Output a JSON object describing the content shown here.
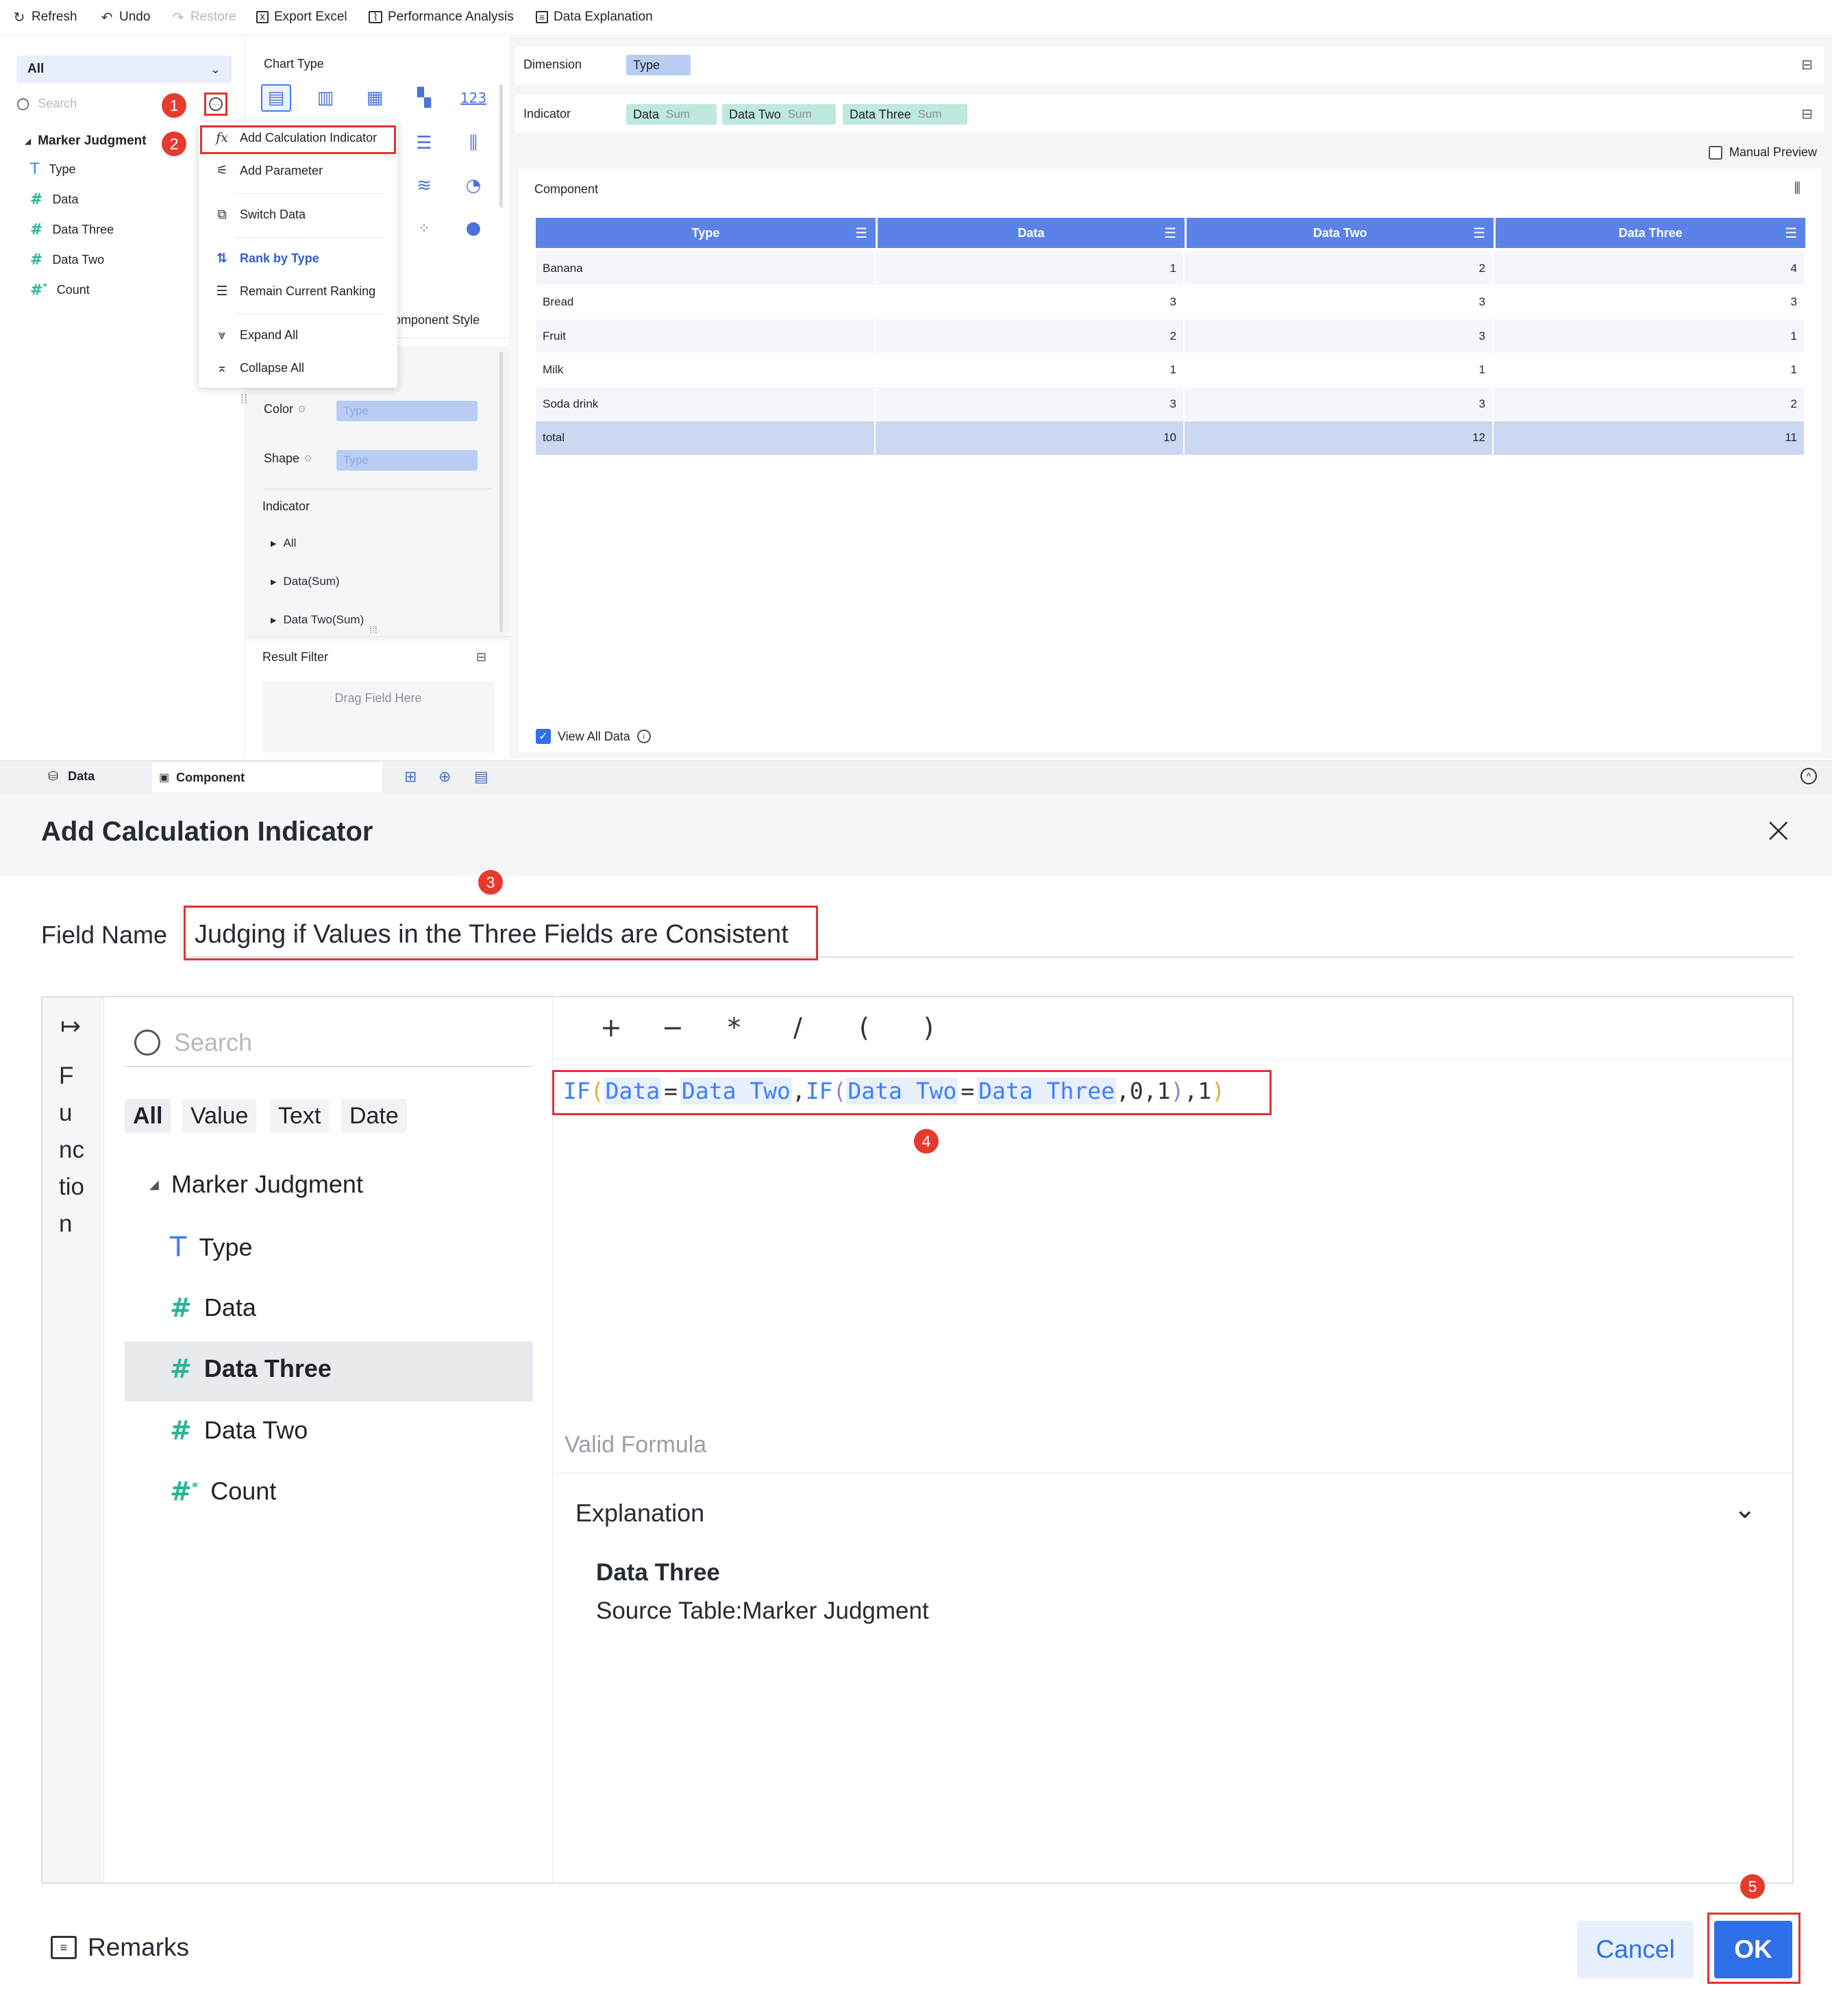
{
  "toolbar": {
    "refresh": "Refresh",
    "undo": "Undo",
    "restore": "Restore",
    "export_excel": "Export Excel",
    "performance_analysis": "Performance Analysis",
    "data_explanation": "Data Explanation"
  },
  "left_panel": {
    "filter_select": "All",
    "search_placeholder": "Search",
    "table_name": "Marker Judgment",
    "fields": [
      {
        "name": "Type",
        "icon": "text-type-icon"
      },
      {
        "name": "Data",
        "icon": "number-icon"
      },
      {
        "name": "Data Three",
        "icon": "number-icon"
      },
      {
        "name": "Data Two",
        "icon": "number-icon"
      },
      {
        "name": "Count",
        "icon": "number-calc-icon"
      }
    ]
  },
  "context_menu": {
    "add_calculation_indicator": "Add Calculation Indicator",
    "add_parameter": "Add Parameter",
    "switch_data": "Switch Data",
    "rank_by_type": "Rank by Type",
    "remain_current_ranking": "Remain Current Ranking",
    "expand_all": "Expand All",
    "collapse_all": "Collapse All"
  },
  "middle_panel": {
    "chart_type_label": "Chart Type",
    "component_style_tab": "omponent Style",
    "color_label": "Color",
    "shape_label": "Shape",
    "color_placeholder": "Type",
    "shape_placeholder": "Type",
    "indicator_label": "Indicator",
    "indicator_items": [
      "All",
      "Data(Sum)",
      "Data Two(Sum)"
    ],
    "result_filter_label": "Result Filter",
    "drag_field_here": "Drag Field Here"
  },
  "right_panel": {
    "dimension_label": "Dimension",
    "dimension_pill": "Type",
    "indicator_label": "Indicator",
    "indicator_pills": [
      {
        "name": "Data",
        "agg": "Sum"
      },
      {
        "name": "Data Two",
        "agg": "Sum"
      },
      {
        "name": "Data Three",
        "agg": "Sum"
      }
    ],
    "manual_preview": "Manual Preview",
    "component_label": "Component",
    "view_all_data": "View All Data"
  },
  "table": {
    "columns": [
      "Type",
      "Data",
      "Data Two",
      "Data Three"
    ],
    "rows": [
      [
        "Banana",
        "1",
        "2",
        "4"
      ],
      [
        "Bread",
        "3",
        "3",
        "3"
      ],
      [
        "Fruit",
        "2",
        "3",
        "1"
      ],
      [
        "Milk",
        "1",
        "1",
        "1"
      ],
      [
        "Soda drink",
        "3",
        "3",
        "2"
      ]
    ],
    "total": [
      "total",
      "10",
      "12",
      "11"
    ]
  },
  "bottom_tabs": {
    "data": "Data",
    "component": "Component"
  },
  "dialog": {
    "title": "Add Calculation Indicator",
    "field_name_label": "Field Name",
    "field_name_value": "Judging if Values in the Three Fields are Consistent",
    "side_tab_letters": [
      "F",
      "u",
      "nc",
      "tio",
      "n"
    ],
    "search_placeholder": "Search",
    "filter_tags": [
      "All",
      "Value",
      "Text",
      "Date"
    ],
    "tree_root": "Marker Judgment",
    "tree_fields": [
      "Type",
      "Data",
      "Data Three",
      "Data Two",
      "Count"
    ],
    "operators": [
      "+",
      "−",
      "*",
      "/",
      "(",
      ")"
    ],
    "formula": {
      "f1": "IF",
      "a": "Data",
      "eq": "=",
      "b": "Data Two",
      "comma": ",",
      "f2": "IF",
      "c": "Data Two",
      "d": "Data Three",
      "zero": "0",
      "one": "1"
    },
    "valid_formula": "Valid Formula",
    "explanation_label": "Explanation",
    "explanation_title": "Data Three",
    "explanation_source": "Source Table:Marker Judgment",
    "remarks": "Remarks",
    "cancel": "Cancel",
    "ok": "OK"
  },
  "badges": [
    "1",
    "2",
    "3",
    "4",
    "5"
  ],
  "colors": {
    "accent": "#3d7eff",
    "header_blue": "#5b82e8",
    "highlight_red": "#e23232",
    "ok_blue": "#2f6fe8"
  }
}
